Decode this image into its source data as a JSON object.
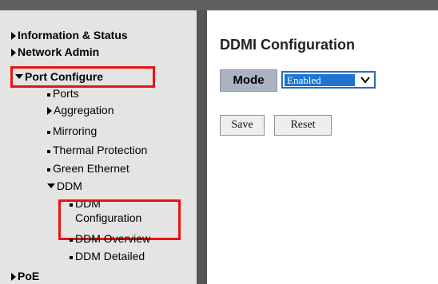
{
  "sidebar": {
    "information_status": "Information & Status",
    "network_admin": "Network Admin",
    "port_configure": "Port Configure",
    "ports": "Ports",
    "aggregation": "Aggregation",
    "mirroring": "Mirroring",
    "thermal_protection": "Thermal Protection",
    "green_ethernet": "Green Ethernet",
    "ddm": "DDM",
    "ddm_configuration_line1": "DDM",
    "ddm_configuration_line2": "Configuration",
    "ddm_overview": "DDM Overview",
    "ddm_detailed": "DDM Detailed",
    "poe": "PoE"
  },
  "main": {
    "title": "DDMI Configuration",
    "mode_label": "Mode",
    "mode_value": "Enabled",
    "save_label": "Save",
    "reset_label": "Reset"
  },
  "colors": {
    "highlight": "#ee1111",
    "select_highlight": "#1e74d0",
    "mode_label_bg": "#aab3c1"
  }
}
